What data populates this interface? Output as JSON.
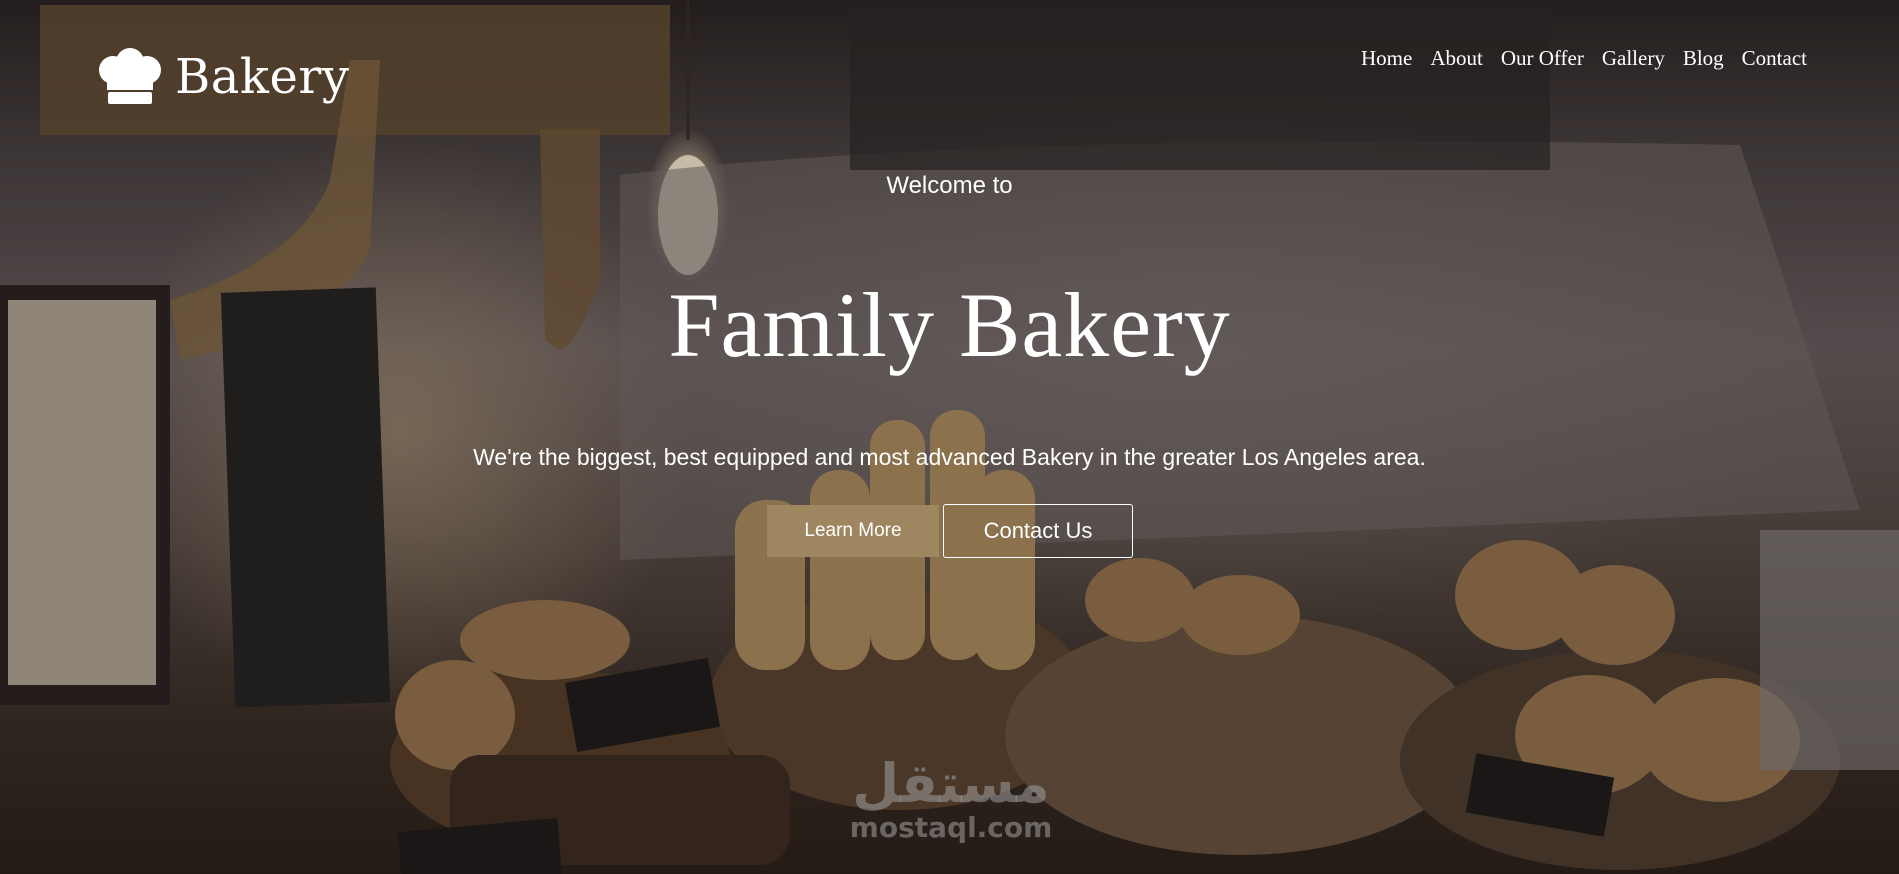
{
  "brand": {
    "name": "Bakery",
    "icon": "chef-hat-icon"
  },
  "nav": {
    "items": [
      {
        "label": "Home"
      },
      {
        "label": "About"
      },
      {
        "label": "Our Offer"
      },
      {
        "label": "Gallery"
      },
      {
        "label": "Blog"
      },
      {
        "label": "Contact"
      }
    ]
  },
  "hero": {
    "welcome": "Welcome to",
    "title": "Family Bakery",
    "subtitle": "We're the biggest, best equipped and most advanced Bakery in the greater Los Angeles area.",
    "primary_button": "Learn More",
    "secondary_button": "Contact Us"
  },
  "watermark": {
    "arabic": "مستقل",
    "latin": "mostaql.com"
  },
  "colors": {
    "accent": "#9e8660",
    "text": "#ffffff"
  }
}
